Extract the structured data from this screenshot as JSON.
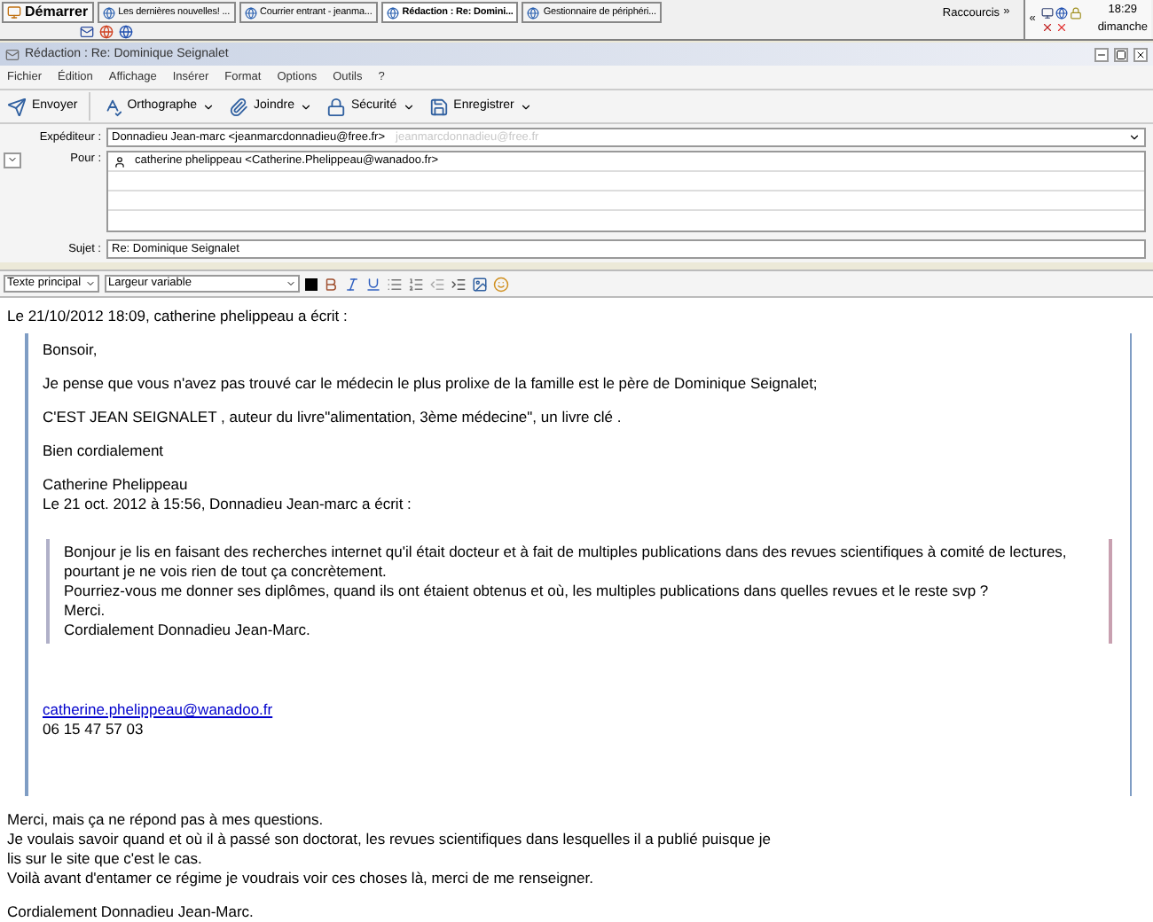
{
  "taskbar": {
    "start": "Démarrer",
    "tasks": [
      {
        "label": "Les dernières nouvelles! ...",
        "selected": false
      },
      {
        "label": "Courrier entrant - jeanma...",
        "selected": false
      },
      {
        "label": "Rédaction : Re: Domini...",
        "selected": true
      },
      {
        "label": "Gestionnaire de périphéri...",
        "selected": false
      }
    ],
    "shortcuts": "Raccourcis",
    "shortcuts_arrow": "»",
    "tray_arrow": "«",
    "time": "18:29",
    "day": "dimanche"
  },
  "window": {
    "title": "Rédaction : Re: Dominique Seignalet"
  },
  "menu": [
    "Fichier",
    "Édition",
    "Affichage",
    "Insérer",
    "Format",
    "Options",
    "Outils",
    "?"
  ],
  "toolbar": [
    {
      "kind": "send",
      "label": "Envoyer",
      "dropdown": false
    },
    {
      "kind": "spell",
      "label": "Orthographe",
      "dropdown": true
    },
    {
      "kind": "attach",
      "label": "Joindre",
      "dropdown": true
    },
    {
      "kind": "security",
      "label": "Sécurité",
      "dropdown": true
    },
    {
      "kind": "save",
      "label": "Enregistrer",
      "dropdown": true
    }
  ],
  "header": {
    "from_label": "Expéditeur :",
    "from_value": "Donnadieu Jean-marc <jeanmarcdonnadieu@free.fr>",
    "from_hint": "jeanmarcdonnadieu@free.fr",
    "to_label": "Pour :",
    "to_value": "catherine phelippeau <Catherine.Phelippeau@wanadoo.fr>",
    "subject_label": "Sujet :",
    "subject_value": "Re: Dominique Seignalet"
  },
  "format": {
    "paragraph_style": "Texte principal",
    "font": "Largeur variable"
  },
  "body": {
    "attribution": "Le 21/10/2012 18:09, catherine phelippeau a écrit :",
    "quote": [
      {
        "kind": "text",
        "text": "Bonsoir,"
      },
      {
        "kind": "text",
        "text": "Je pense que vous n'avez pas trouvé car le médecin le plus prolixe de la famille est le père de Dominique Seignalet;"
      },
      {
        "kind": "text",
        "text": "C'EST JEAN SEIGNALET , auteur du livre\"alimentation, 3ème médecine\", un livre clé ."
      },
      {
        "kind": "text",
        "text": "Bien cordialement"
      },
      {
        "kind": "lines",
        "lines": [
          "Catherine Phelippeau",
          "Le 21 oct. 2012 à 15:56, Donnadieu Jean-marc a écrit :"
        ]
      },
      {
        "kind": "quote",
        "lines": [
          "Bonjour je lis en faisant des recherches internet qu'il était docteur et à fait de multiples publications dans des revues scientifiques à comité de lectures, pourtant je ne vois rien de tout ça concrètement.",
          "Pourriez-vous me donner ses diplômes, quand ils ont étaient obtenus et où, les multiples publications dans quelles revues et le reste svp ?",
          "Merci.",
          "Cordialement Donnadieu Jean-Marc."
        ]
      },
      {
        "kind": "link",
        "text": "catherine.phelippeau@wanadoo.fr"
      },
      {
        "kind": "plain",
        "text": "06 15 47 57 03"
      }
    ],
    "reply": [
      [
        "Merci, mais ça ne répond pas à mes questions.",
        "Je voulais savoir quand et où il à passé son doctorat, les revues scientifiques dans lesquelles il a publié puisque je lis sur le site que c'est le cas.",
        "Voilà avant d'entamer ce régime je voudrais voir ces choses là, merci de me renseigner."
      ],
      [
        "Cordialement Donnadieu Jean-Marc."
      ]
    ]
  }
}
